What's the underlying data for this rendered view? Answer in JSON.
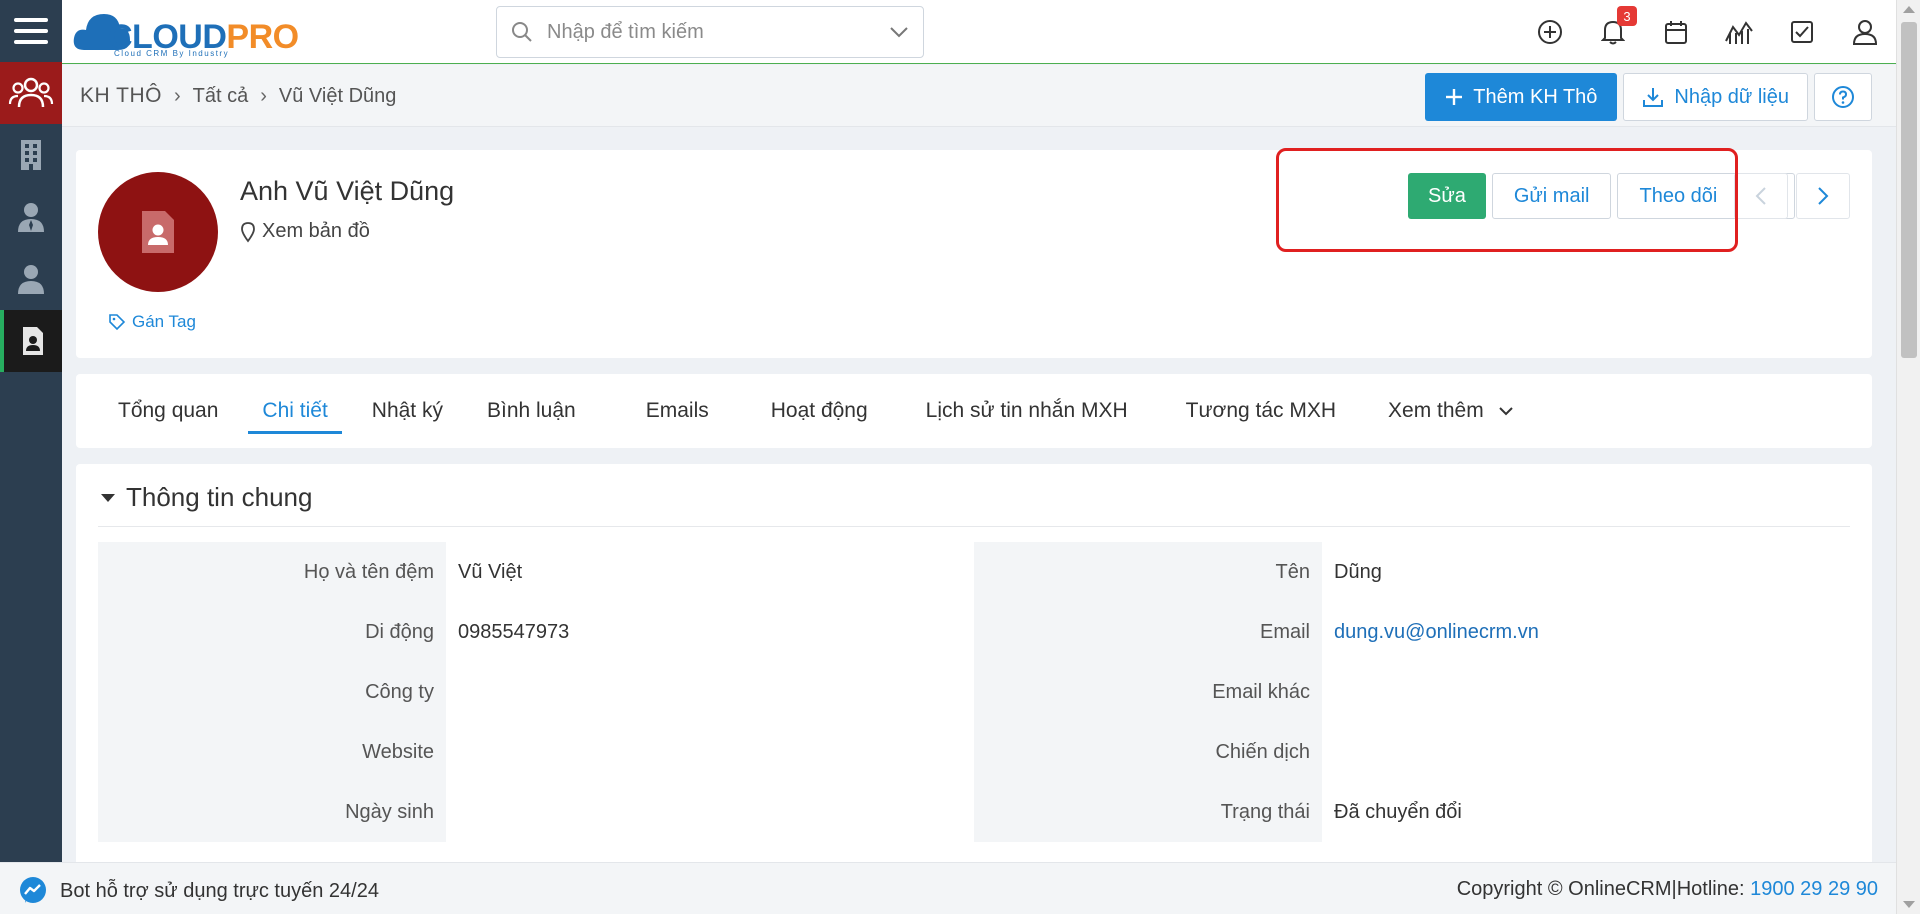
{
  "app": {
    "logo_main": "CLOUD",
    "logo_accent": "PRO",
    "logo_sub": "Cloud CRM By Industry"
  },
  "search": {
    "placeholder": "Nhập để tìm kiếm"
  },
  "header": {
    "notification_count": "3"
  },
  "breadcrumb": {
    "root": "KH THÔ",
    "level2": "Tất cả",
    "current": "Vũ Việt Dũng"
  },
  "toolbar": {
    "add_label": "Thêm KH Thô",
    "import_label": "Nhập dữ liệu"
  },
  "profile": {
    "name": "Anh Vũ Việt Dũng",
    "map_label": "Xem bản đồ",
    "tag_label": "Gán Tag",
    "edit_label": "Sửa",
    "send_mail_label": "Gửi mail",
    "follow_label": "Theo dõi"
  },
  "tabs": [
    {
      "label": "Tổng quan"
    },
    {
      "label": "Chi tiết"
    },
    {
      "label": "Nhật ký"
    },
    {
      "label": "Bình luận"
    },
    {
      "label": "Emails"
    },
    {
      "label": "Hoạt động"
    },
    {
      "label": "Lịch sử tin nhắn MXH"
    },
    {
      "label": "Tương tác MXH"
    },
    {
      "label": "Xem thêm"
    }
  ],
  "section": {
    "title": "Thông tin chung",
    "left": [
      {
        "label": "Họ và tên đệm",
        "value": "Vũ Việt"
      },
      {
        "label": "Di động",
        "value": "0985547973"
      },
      {
        "label": "Công ty",
        "value": ""
      },
      {
        "label": "Website",
        "value": ""
      },
      {
        "label": "Ngày sinh",
        "value": ""
      }
    ],
    "right": [
      {
        "label": "Tên",
        "value": "Dũng"
      },
      {
        "label": "Email",
        "value": "dung.vu@onlinecrm.vn"
      },
      {
        "label": "Email khác",
        "value": ""
      },
      {
        "label": "Chiến dịch",
        "value": ""
      },
      {
        "label": "Trạng thái",
        "value": "Đã chuyển đổi"
      }
    ]
  },
  "footer": {
    "bot_text": "Bot hỗ trợ sử dụng trực tuyến 24/24",
    "copyright": "Copyright © OnlineCRM",
    "hotline_label": "Hotline:",
    "hotline": "1900 29 29 90"
  },
  "colors": {
    "primary": "#1e88d8",
    "edit_green": "#2eaa72",
    "avatar_red": "#8e1212",
    "sidebar": "#2c3e50",
    "highlight_red": "#e02020"
  }
}
